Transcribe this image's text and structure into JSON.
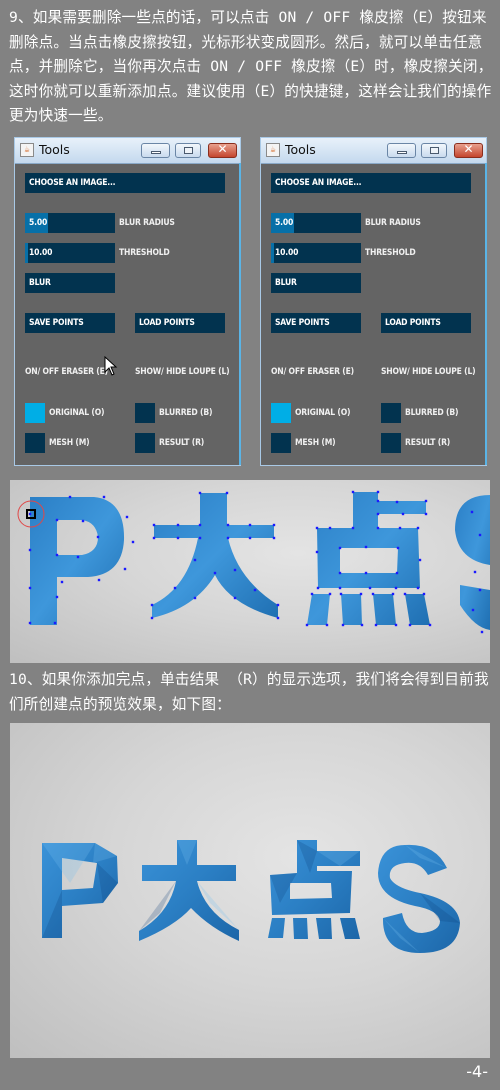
{
  "step9": {
    "text": "9、如果需要删除一些点的话，可以点击 ON / OFF 橡皮擦（E）按钮来删除点。当点击橡皮擦按钮，光标形状变成圆形。然后，就可以单击任意点，并删除它，当你再次点击 ON / OFF 橡皮擦（E）时，橡皮擦关闭，这时你就可以重新添加点。建议使用（E）的快捷键，这样会让我们的操作更为快速一些。"
  },
  "tools_windows": [
    {
      "title": "Tools",
      "choose_image": "CHOOSE AN IMAGE...",
      "blur_radius": {
        "value": "5.00",
        "label": "BLUR RADIUS",
        "fill_fraction": 0.25
      },
      "threshold": {
        "value": "10.00",
        "label": "THRESHOLD",
        "fill_fraction": 0.03
      },
      "blur_button": "BLUR",
      "save_points": "SAVE POINTS",
      "load_points": "LOAD POINTS",
      "eraser": {
        "label": "ON/ OFF ERASER (E)",
        "state": "hover"
      },
      "loupe": {
        "label": "SHOW/ HIDE LOUPE (L)",
        "state": "off"
      },
      "views": [
        {
          "label": "ORIGINAL (O)",
          "on": true
        },
        {
          "label": "BLURRED (B)",
          "on": false
        },
        {
          "label": "MESH (M)",
          "on": false
        },
        {
          "label": "RESULT (R)",
          "on": false
        }
      ],
      "cursor": "arrow-cursor"
    },
    {
      "title": "Tools",
      "choose_image": "CHOOSE AN IMAGE...",
      "blur_radius": {
        "value": "5.00",
        "label": "BLUR RADIUS",
        "fill_fraction": 0.25
      },
      "threshold": {
        "value": "10.00",
        "label": "THRESHOLD",
        "fill_fraction": 0.03
      },
      "blur_button": "BLUR",
      "save_points": "SAVE POINTS",
      "load_points": "LOAD POINTS",
      "eraser": {
        "label": "ON/ OFF ERASER (E)",
        "state": "on"
      },
      "loupe": {
        "label": "SHOW/ HIDE LOUPE (L)",
        "state": "off"
      },
      "views": [
        {
          "label": "ORIGINAL (O)",
          "on": true
        },
        {
          "label": "BLURRED (B)",
          "on": false
        },
        {
          "label": "MESH (M)",
          "on": false
        },
        {
          "label": "RESULT (R)",
          "on": false
        }
      ]
    }
  ],
  "photo1": {
    "text": "P大点S",
    "description": "points-on-text",
    "accent": "#2f86cf",
    "point_color": "#1a1aff"
  },
  "step10": {
    "text": "10、如果你添加完点，单击结果 （R）的显示选项，我们将会得到目前我们所创建点的预览效果，如下图："
  },
  "photo2": {
    "text": "P大点S",
    "description": "low-poly-result",
    "accent": "#2f86cf"
  },
  "page_number": "-4-",
  "colors": {
    "page_bg": "#828282",
    "control_dark": "#02334f",
    "control_mid": "#0770a8",
    "control_on": "#00aee6",
    "window_bg": "#646464"
  }
}
